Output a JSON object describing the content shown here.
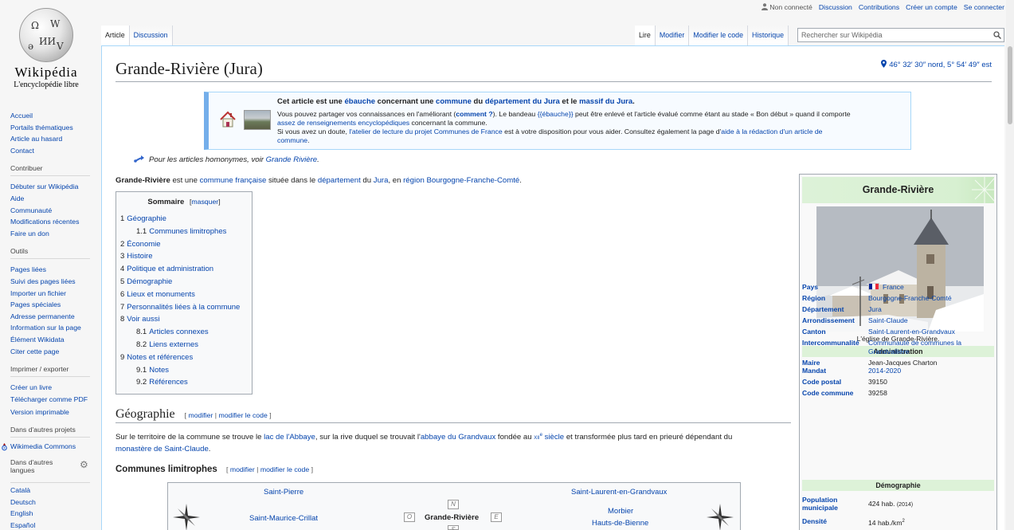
{
  "logo": {
    "wordmark": "Wikipédia",
    "tagline": "L'encyclopédie libre"
  },
  "personal": {
    "status": "Non connecté",
    "discussion": "Discussion",
    "contributions": "Contributions",
    "create_account": "Créer un compte",
    "login": "Se connecter"
  },
  "tabs": {
    "article": "Article",
    "discussion": "Discussion",
    "read": "Lire",
    "edit": "Modifier",
    "edit_source": "Modifier le code",
    "history": "Historique"
  },
  "search": {
    "placeholder": "Rechercher sur Wikipédia"
  },
  "sidebar": {
    "nav": [
      "Accueil",
      "Portails thématiques",
      "Article au hasard",
      "Contact"
    ],
    "contribute_title": "Contribuer",
    "contribute": [
      "Débuter sur Wikipédia",
      "Aide",
      "Communauté",
      "Modifications récentes",
      "Faire un don"
    ],
    "tools_title": "Outils",
    "tools": [
      "Pages liées",
      "Suivi des pages liées",
      "Importer un fichier",
      "Pages spéciales",
      "Adresse permanente",
      "Information sur la page",
      "Élément Wikidata",
      "Citer cette page"
    ],
    "print_title": "Imprimer / exporter",
    "print": [
      "Créer un livre",
      "Télécharger comme PDF",
      "Version imprimable"
    ],
    "other_projects_title": "Dans d'autres projets",
    "other_projects": [
      "Wikimedia Commons"
    ],
    "languages_title": "Dans d'autres langues",
    "languages": [
      "Català",
      "Deutsch",
      "English",
      "Español"
    ]
  },
  "article": {
    "title": "Grande-Rivière (Jura)",
    "coords": "46° 32′ 30″ nord, 5° 54′ 49″ est",
    "banner": {
      "line1_a": "Cet article est une ",
      "line1_link1": "ébauche",
      "line1_b": " concernant une ",
      "line1_link2": "commune",
      "line1_c": " du ",
      "line1_link3": "département du Jura",
      "line1_d": " et le ",
      "line1_link4": "massif du Jura",
      "line1_e": ".",
      "line2_a": "Vous pouvez partager vos connaissances en l'améliorant (",
      "line2_link1": "comment ?",
      "line2_b": "). Le bandeau ",
      "line2_link2": "{{ébauche}}",
      "line2_c": " peut être enlevé et l'article évalué comme étant au stade « Bon début » quand il comporte",
      "line3_link": "assez de renseignements encyclopédiques",
      "line3_b": " concernant la commune.",
      "line4_a": "Si vous avez un doute, ",
      "line4_link1": "l'atelier de lecture du projet Communes de France",
      "line4_b": " est à votre disposition pour vous aider. Consultez également la page d'",
      "line4_link2": "aide à la rédaction d'un article de",
      "line5_link": "commune",
      "line5_b": "."
    },
    "homonym_a": "Pour les articles homonymes, voir ",
    "homonym_link": "Grande Rivière",
    "homonym_b": ".",
    "intro": {
      "bold": "Grande-Rivière",
      "a": " est une ",
      "l1": "commune française",
      "b": " située dans le ",
      "l2": "département",
      "c": " du ",
      "l3": "Jura",
      "d": ", en ",
      "l4": "région Bourgogne-Franche-Comté",
      "e": "."
    },
    "toc": {
      "title": "Sommaire",
      "hide": "masquer",
      "items": [
        {
          "num": "1",
          "label": "Géographie",
          "level": 1
        },
        {
          "num": "1.1",
          "label": "Communes limitrophes",
          "level": 2
        },
        {
          "num": "2",
          "label": "Économie",
          "level": 1
        },
        {
          "num": "3",
          "label": "Histoire",
          "level": 1
        },
        {
          "num": "4",
          "label": "Politique et administration",
          "level": 1
        },
        {
          "num": "5",
          "label": "Démographie",
          "level": 1
        },
        {
          "num": "6",
          "label": "Lieux et monuments",
          "level": 1
        },
        {
          "num": "7",
          "label": "Personnalités liées à la commune",
          "level": 1
        },
        {
          "num": "8",
          "label": "Voir aussi",
          "level": 1
        },
        {
          "num": "8.1",
          "label": "Articles connexes",
          "level": 2
        },
        {
          "num": "8.2",
          "label": "Liens externes",
          "level": 2
        },
        {
          "num": "9",
          "label": "Notes et références",
          "level": 1
        },
        {
          "num": "9.1",
          "label": "Notes",
          "level": 2
        },
        {
          "num": "9.2",
          "label": "Références",
          "level": 2
        }
      ]
    },
    "geo": {
      "heading": "Géographie",
      "edit": "modifier",
      "edit_source": "modifier le code",
      "t1": "Sur le territoire de la commune se trouve le ",
      "l1": "lac de l'Abbaye",
      "t2": ", sur la rive duquel se trouvait l'",
      "l2": "abbaye du Grandvaux",
      "t3": " fondée au ",
      "century": "xii",
      "sup": "e",
      "l3": " siècle",
      "t4": " et transformée plus tard en prieuré dépendant du",
      "l4": "monastère de Saint-Claude",
      "t5": "."
    },
    "communes": {
      "heading": "Communes limitrophes",
      "edit": "modifier",
      "edit_source": "modifier le code",
      "nw": "Saint-Pierre",
      "ne": "Saint-Laurent-en-Grandvaux",
      "w": "Saint-Maurice-Crillat",
      "center": "Grande-Rivière",
      "e1": "Morbier",
      "e2": "Hauts-de-Bienne",
      "n": "N",
      "o": "O",
      "east": "E",
      "s": "S"
    }
  },
  "infobox": {
    "title": "Grande-Rivière",
    "caption": "L'église de Grande-Rivière.",
    "admin_title": "Administration",
    "rows": [
      {
        "k": "Pays",
        "v": "France"
      },
      {
        "k": "Région",
        "v": "Bourgogne-Franche-Comté"
      },
      {
        "k": "Département",
        "v": "Jura"
      },
      {
        "k": "Arrondissement",
        "v": "Saint-Claude"
      },
      {
        "k": "Canton",
        "v": "Saint-Laurent-en-Grandvaux"
      },
      {
        "k": "Intercommunalité",
        "v": "Communauté de communes la Grandvallière"
      },
      {
        "k": "Maire",
        "v": "Jean-Jacques Charton"
      },
      {
        "k": "Mandat",
        "v": "2014-2020"
      },
      {
        "k": "Code postal",
        "v": "39150"
      },
      {
        "k": "Code commune",
        "v": "39258"
      }
    ],
    "demo_title": "Démographie",
    "population_k": "Population municipale",
    "population_v": "424 hab.",
    "population_year": "(2014)",
    "density_k": "Densité",
    "density_v": "14 hab./km",
    "density_sup": "2"
  },
  "colors": {
    "link": "#0645ad",
    "infobox_header": "#ddf2d8",
    "banner_stripe": "#74aeea"
  }
}
